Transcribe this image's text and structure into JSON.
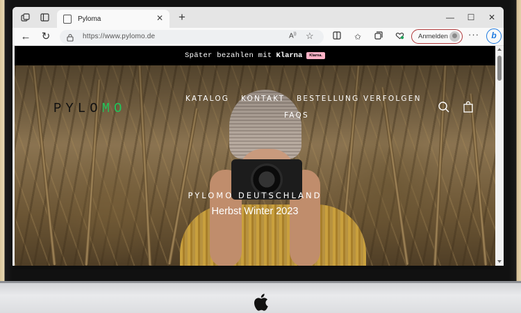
{
  "browser": {
    "tab": {
      "title": "Pyloma"
    },
    "address": {
      "url": "https://www.pylomo.de"
    },
    "signin_label": "Anmelden"
  },
  "site": {
    "promo": {
      "text": "Später bezahlen mit",
      "brand": "Klarna",
      "badge": "Klarna."
    },
    "logo": {
      "part1": "PYLO",
      "part2": "MO",
      "accent": "#22c45a"
    },
    "nav": [
      {
        "label": "KATALOG"
      },
      {
        "label": "KONTAKT"
      },
      {
        "label": "BESTELLUNG VERFOLGEN"
      },
      {
        "label": "FAQS"
      }
    ],
    "hero": {
      "title": "PYLOMO DEUTSCHLAND",
      "subtitle": "Herbst Winter 2023"
    }
  },
  "colors": {
    "signin_border": "#b0383a",
    "edge_blue": "#1d7ae0",
    "klarna_pink": "#ffb3c7"
  },
  "icons": [
    "workspaces-icon",
    "tab-actions-icon",
    "page-icon",
    "close-icon",
    "plus-icon",
    "minimize-icon",
    "maximize-icon",
    "back-icon",
    "refresh-icon",
    "lock-icon",
    "read-aloud-icon",
    "star-icon",
    "split-screen-icon",
    "favorites-icon",
    "collections-icon",
    "extensions-icon",
    "avatar",
    "more-icon",
    "bing-icon",
    "search-icon",
    "bag-icon",
    "apple-logo"
  ]
}
